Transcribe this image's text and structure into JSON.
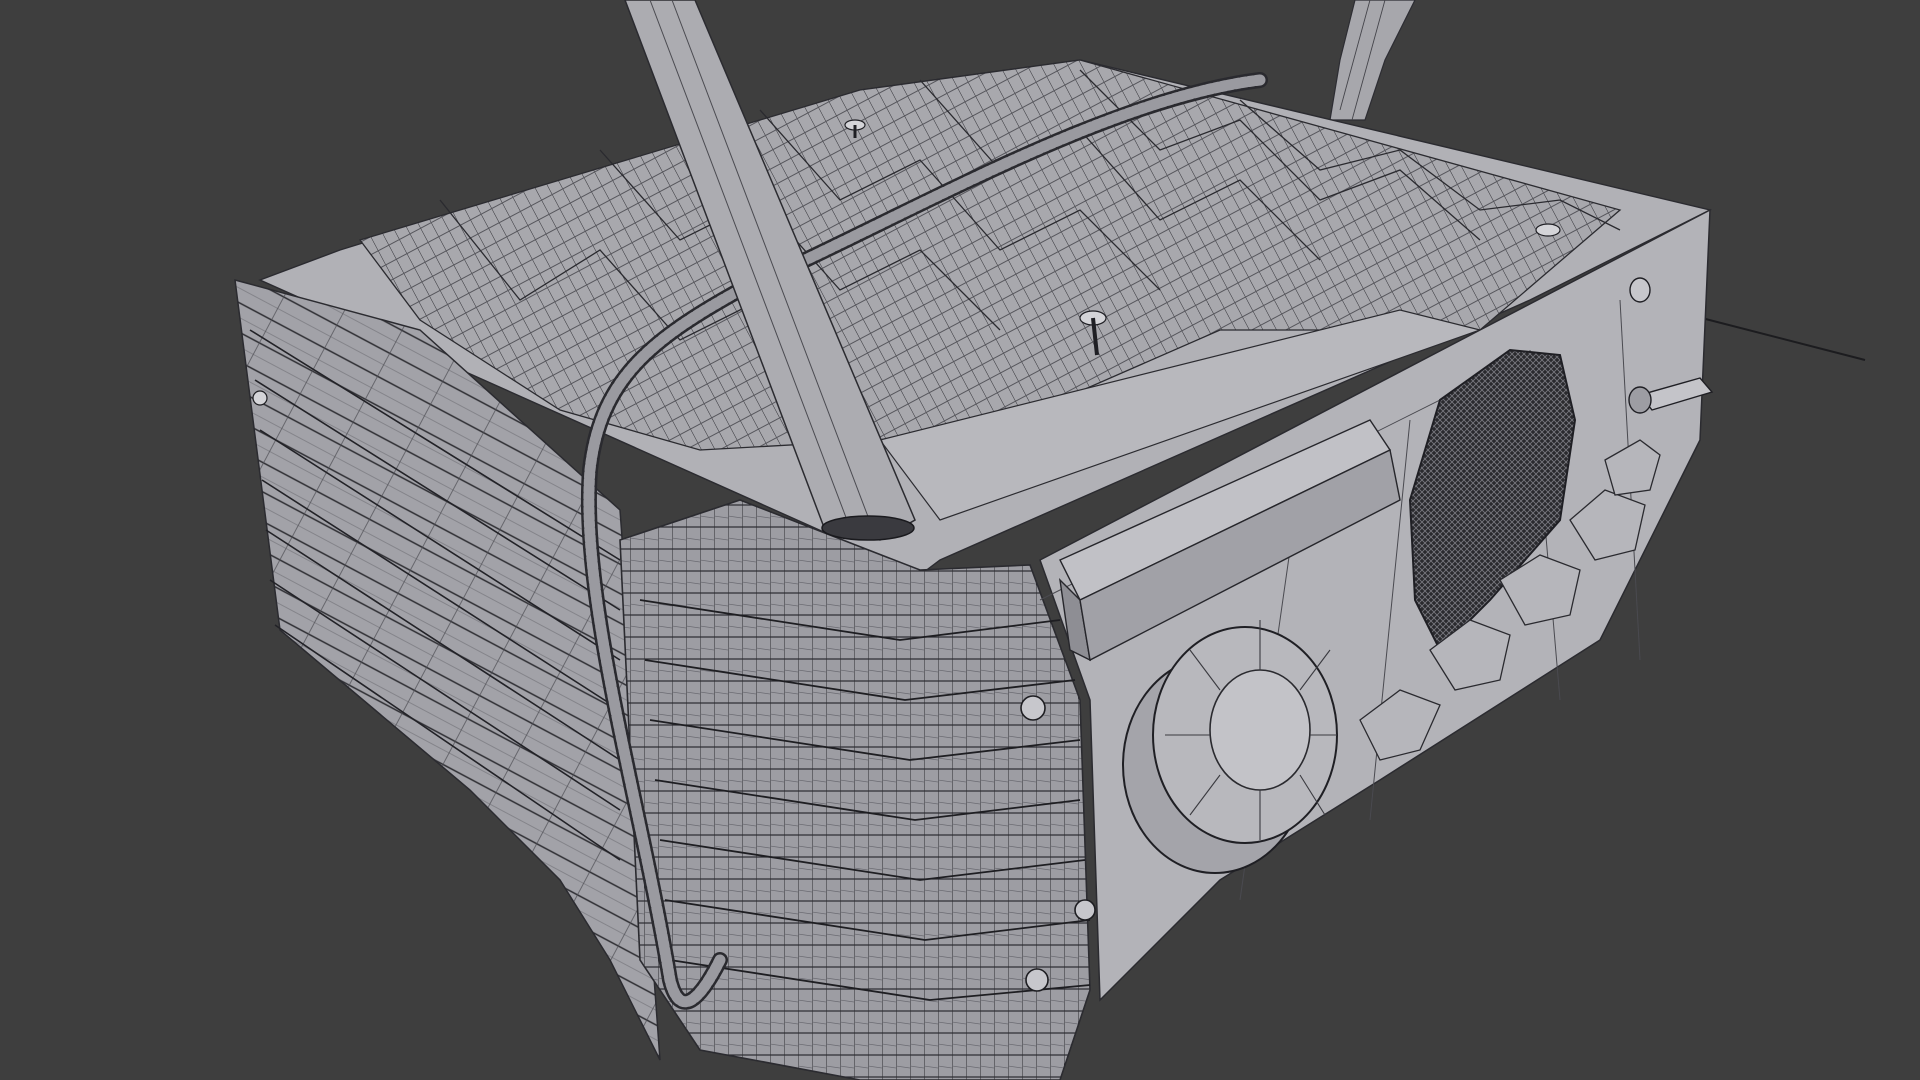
{
  "viewport": {
    "mode": "3d-wireframe-overlay",
    "background_color": "#3e3e3e",
    "mesh_color": "#a9a9ae",
    "mesh_shadow_color": "#7c7c82",
    "wire_color": "#1a1a1a"
  },
  "model": {
    "subject": "boxy-radio-with-antennas",
    "parts": [
      "radio-body",
      "top-panel-with-folds",
      "left-pleated-panel",
      "front-pleated-panel",
      "antenna-left",
      "antenna-right",
      "cable",
      "tuning-dial",
      "speaker-grille",
      "handle-bar",
      "side-toggle-switch",
      "pins"
    ]
  }
}
